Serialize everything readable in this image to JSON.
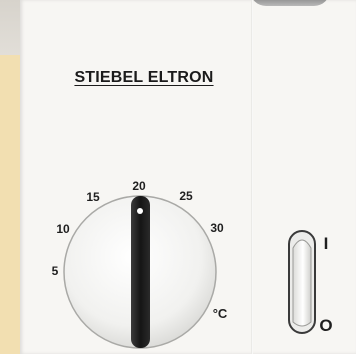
{
  "device": {
    "brand": "STIEBEL ELTRON"
  },
  "thermostat": {
    "scale_labels": [
      "5",
      "10",
      "15",
      "20",
      "25",
      "30"
    ],
    "unit": "°C",
    "selected_value": 20
  },
  "power_switch": {
    "on_label": "I",
    "off_label": "O",
    "state": "on"
  },
  "colors": {
    "wall_accent": "#f2dfb1",
    "panel": "#f7f6f3",
    "knob_grip": "#1d1d1d",
    "text": "#1f1f1f"
  }
}
